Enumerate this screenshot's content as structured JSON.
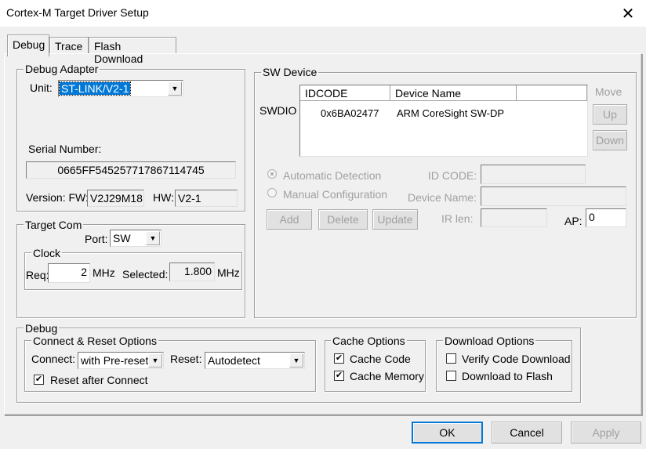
{
  "window": {
    "title": "Cortex-M Target Driver Setup"
  },
  "tabs": [
    "Debug",
    "Trace",
    "Flash Download"
  ],
  "debug_adapter": {
    "legend": "Debug Adapter",
    "unit_label": "Unit:",
    "unit_value": "ST-LINK/V2-1",
    "serial_label": "Serial Number:",
    "serial_value": "0665FF545257717867114745",
    "version_label": "Version: FW:",
    "fw_value": "V2J29M18",
    "hw_label": "HW:",
    "hw_value": "V2-1"
  },
  "target_com": {
    "legend": "Target Com",
    "port_label": "Port:",
    "port_value": "SW",
    "clock_legend": "Clock",
    "req_label": "Req:",
    "req_value": "2",
    "mhz": "MHz",
    "selected_label": "Selected:",
    "selected_value": "1.800",
    "selected_unit": "MHz"
  },
  "sw_device": {
    "legend": "SW Device",
    "swdio_label": "SWDIO",
    "columns": [
      "IDCODE",
      "Device Name"
    ],
    "rows": [
      {
        "idcode": "0x6BA02477",
        "name": "ARM CoreSight SW-DP"
      }
    ],
    "move_label": "Move",
    "up_label": "Up",
    "down_label": "Down",
    "auto_detect_label": "Automatic Detection",
    "manual_config_label": "Manual Configuration",
    "id_code_label": "ID CODE:",
    "device_name_label": "Device Name:",
    "ir_len_label": "IR len:",
    "ap_label": "AP:",
    "ap_value": "0",
    "add_label": "Add",
    "delete_label": "Delete",
    "update_label": "Update"
  },
  "debug": {
    "legend": "Debug",
    "connect_reset": {
      "legend": "Connect & Reset Options",
      "connect_label": "Connect:",
      "connect_value": "with Pre-reset",
      "reset_label": "Reset:",
      "reset_value": "Autodetect",
      "reset_after_connect_label": "Reset after Connect",
      "reset_after_connect_checked": true
    },
    "cache": {
      "legend": "Cache Options",
      "cache_code_label": "Cache Code",
      "cache_code_checked": true,
      "cache_memory_label": "Cache Memory",
      "cache_memory_checked": true
    },
    "download": {
      "legend": "Download Options",
      "verify_label": "Verify Code Download",
      "verify_checked": false,
      "flash_label": "Download to Flash",
      "flash_checked": false
    }
  },
  "footer": {
    "ok_label": "OK",
    "cancel_label": "Cancel",
    "apply_label": "Apply"
  },
  "icons": {
    "close": "close-icon",
    "dropdown": "chevron-down-icon",
    "check": "checkmark-icon"
  }
}
